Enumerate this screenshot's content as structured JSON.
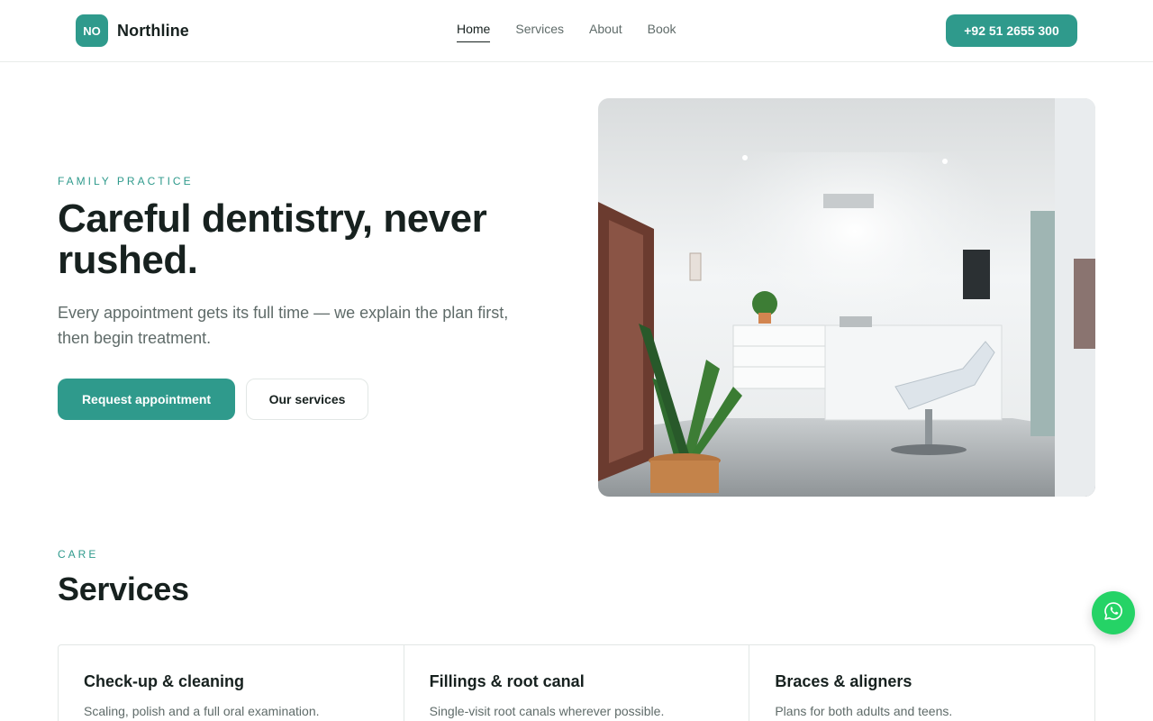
{
  "brand": {
    "initials": "NO",
    "name": "Northline",
    "accent": "#2f9a8c"
  },
  "nav": {
    "items": [
      {
        "label": "Home",
        "active": true
      },
      {
        "label": "Services"
      },
      {
        "label": "About"
      },
      {
        "label": "Book"
      }
    ]
  },
  "header": {
    "phone": "+92 51 2655 300"
  },
  "hero": {
    "eyebrow": "FAMILY PRACTICE",
    "title": "Careful dentistry, never rushed.",
    "subtitle": "Every appointment gets its full time — we explain the plan first, then begin treatment.",
    "primary_cta": "Request appointment",
    "secondary_cta": "Our services"
  },
  "services": {
    "eyebrow": "CARE",
    "title": "Services",
    "items": [
      {
        "title": "Check-up & cleaning",
        "description": "Scaling, polish and a full oral examination."
      },
      {
        "title": "Fillings & root canal",
        "description": "Single-visit root canals wherever possible."
      },
      {
        "title": "Braces & aligners",
        "description": "Plans for both adults and teens."
      }
    ]
  },
  "floating": {
    "icon": "whatsapp-icon",
    "color": "#25d366"
  }
}
